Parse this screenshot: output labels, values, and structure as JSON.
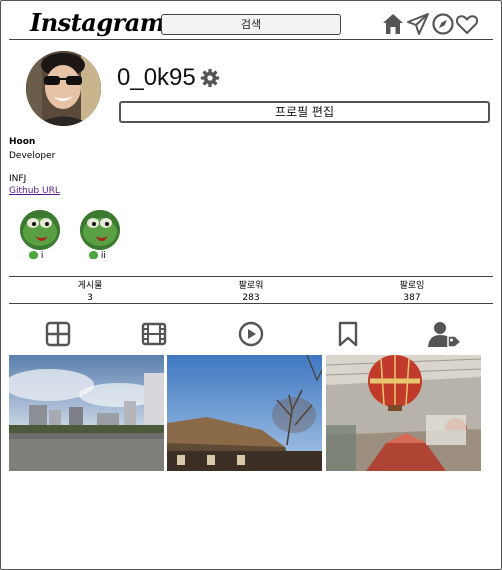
{
  "header": {
    "logo": "Instagram",
    "search_label": "검색",
    "icons": [
      "home-icon",
      "send-icon",
      "explore-icon",
      "heart-icon"
    ]
  },
  "profile": {
    "username": "0_0k95",
    "edit_label": "프로필 편집",
    "name": "Hoon",
    "job": "Developer",
    "mbti": "INFJ",
    "link": "Github URL"
  },
  "highlights": [
    {
      "label": "i"
    },
    {
      "label": "ii"
    }
  ],
  "stats": {
    "posts_label": "게시물",
    "posts_value": "3",
    "followers_label": "팔로워",
    "followers_value": "283",
    "following_label": "팔로잉",
    "following_value": "387"
  },
  "tabs": [
    "grid-icon",
    "reels-icon",
    "video-icon",
    "saved-icon",
    "tagged-icon"
  ],
  "colors": {
    "icon": "#555555",
    "link": "#551a8b",
    "border": "#444444"
  }
}
